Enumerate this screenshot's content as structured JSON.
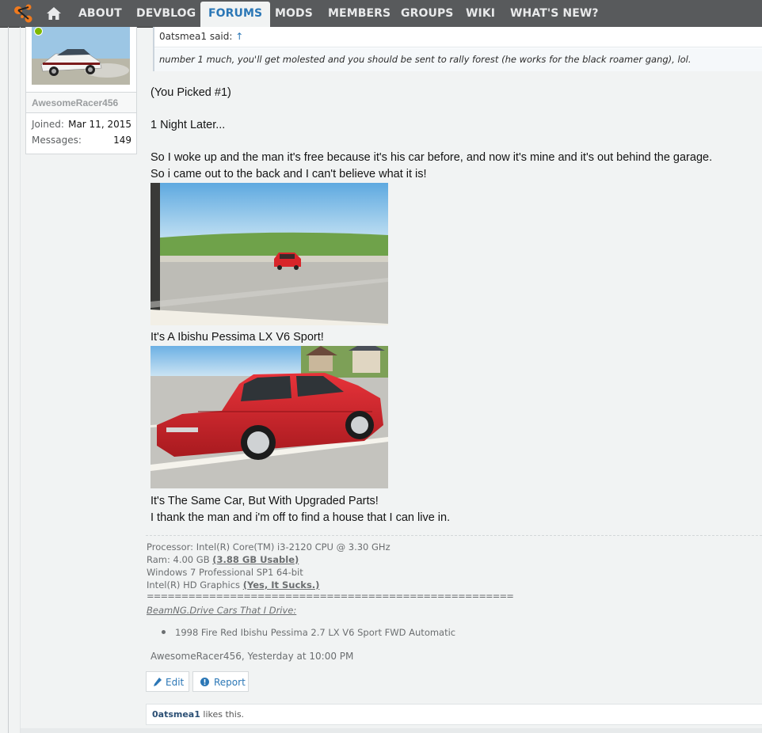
{
  "nav": {
    "items": [
      "ABOUT",
      "DEVBLOG",
      "FORUMS",
      "MODS",
      "MEMBERS",
      "GROUPS",
      "WIKI",
      "WHAT'S NEW?"
    ],
    "active": "FORUMS",
    "icons": [
      "beamng-logo-icon",
      "home-icon"
    ]
  },
  "profile": {
    "username": "AwesomeRacer456",
    "joined_label": "Joined:",
    "joined_value": "Mar 11, 2015",
    "messages_label": "Messages:",
    "messages_value": "149",
    "online_color": "#7fb900"
  },
  "quote": {
    "author_said": "0atsmea1 said:",
    "arrow": "↑",
    "text": "number 1 much, you'll get molested and you should be sent to rally forest (he works for the black roamer gang), lol."
  },
  "post": {
    "line1": "(You Picked #1)",
    "line2": "1 Night Later...",
    "line3": "So I woke up and the man it's free because it's his car before, and now it's mine and it's out behind the garage.",
    "line4": "So i came out to the back and I can't believe what it is!",
    "caption1": "It's A Ibishu Pessima LX V6 Sport!",
    "line5": "It's The Same Car, But With Upgraded Parts!",
    "line6": "I thank the man and i'm off to find a house that I can live in."
  },
  "signature": {
    "processor": "Processor: Intel(R) Core(TM) i3-2120 CPU @ 3.30 GHz",
    "ram_prefix": "Ram: 4.00 GB ",
    "ram_bold": "(3.88 GB Usable)",
    "os": "Windows 7 Professional SP1 64-bit",
    "gpu_prefix": "Intel(R) HD Graphics ",
    "gpu_bold": "(Yes, It Sucks.)",
    "separator": "=====================================================",
    "cars_title": "BeamNG.Drive Cars That I Drive:",
    "car1": "1998 Fire Red Ibishu Pessima 2.7 LX V6 Sport FWD Automatic"
  },
  "meta": {
    "byline": "AwesomeRacer456, Yesterday at 10:00 PM",
    "edit_label": "Edit",
    "report_label": "Report",
    "likes_user": "0atsmea1",
    "likes_suffix": " likes this."
  },
  "colors": {
    "nav_bg": "#585a5c",
    "accent": "#2b77b6",
    "car_red": "#d8252a"
  }
}
